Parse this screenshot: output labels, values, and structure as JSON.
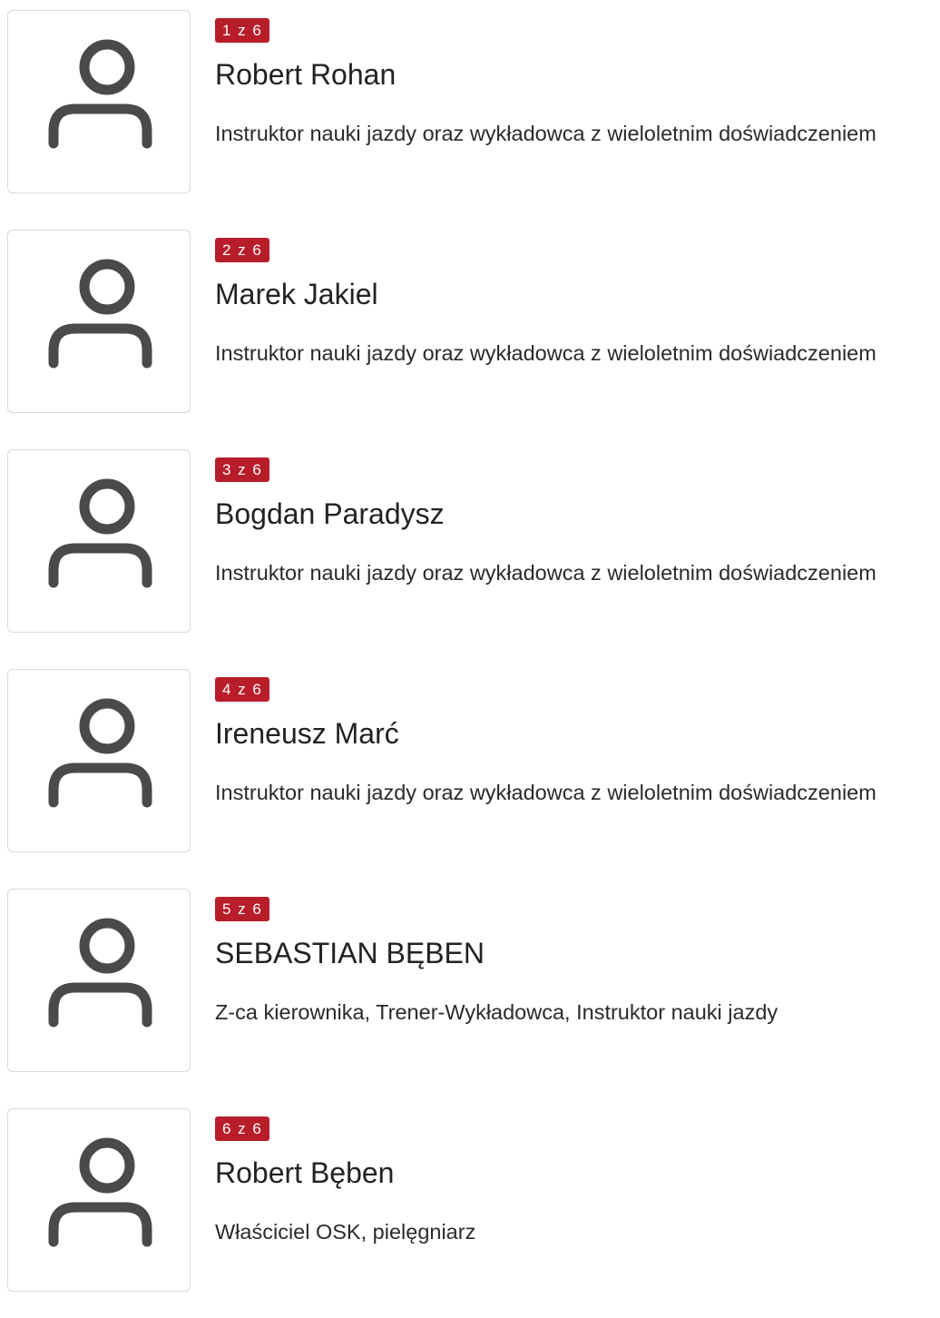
{
  "instructors": [
    {
      "counter": "1 z 6",
      "name": "Robert Rohan",
      "description": "Instruktor nauki jazdy oraz wykładowca z wieloletnim doświadczeniem",
      "icon": "user-icon"
    },
    {
      "counter": "2 z 6",
      "name": "Marek Jakiel",
      "description": "Instruktor nauki jazdy oraz wykładowca z wieloletnim doświadczeniem",
      "icon": "user-icon"
    },
    {
      "counter": "3 z 6",
      "name": "Bogdan Paradysz",
      "description": "Instruktor nauki jazdy oraz wykładowca z wieloletnim doświadczeniem",
      "icon": "user-icon"
    },
    {
      "counter": "4 z 6",
      "name": "Ireneusz Marć",
      "description": "Instruktor nauki jazdy oraz wykładowca z wieloletnim doświadczeniem",
      "icon": "user-icon"
    },
    {
      "counter": "5 z 6",
      "name": "SEBASTIAN BĘBEN",
      "description": "Z-ca kierownika, Trener-Wykładowca, Instruktor nauki jazdy",
      "icon": "user-icon"
    },
    {
      "counter": "6 z 6",
      "name": "Robert Bęben",
      "description": "Właściciel OSK, pielęgniarz",
      "icon": "user-icon"
    }
  ],
  "colors": {
    "badge_background": "#b81d2a",
    "badge_text": "#ffffff",
    "icon": "#4a4a4a",
    "avatar_border": "#d9d9d9"
  }
}
